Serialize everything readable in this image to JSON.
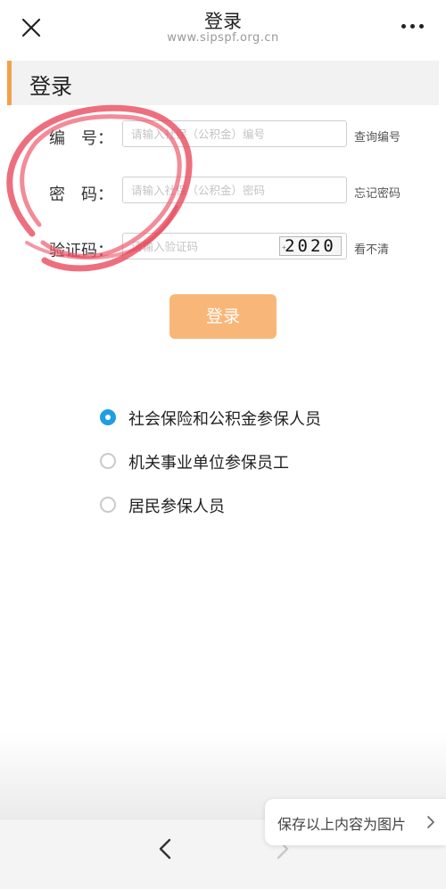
{
  "nav": {
    "title": "登录",
    "url": "www.sipspf.org.cn",
    "close_icon": "close-icon",
    "more_icon": "more-icon"
  },
  "section": {
    "title": "登录"
  },
  "form": {
    "id_label": "编　号：",
    "id_placeholder": "请输入社保（公积金）编号",
    "id_link": "查询编号",
    "password_label": "密　码：",
    "password_placeholder": "请输入社保（公积金）密码",
    "password_link": "忘记密码",
    "captcha_label": "验证码：",
    "captcha_placeholder": "请输入验证码",
    "captcha_value": "2020",
    "captcha_link": "看不清"
  },
  "login_button": {
    "label": "登录"
  },
  "user_types": {
    "selected_index": 0,
    "options": [
      {
        "label": "社会保险和公积金参保人员",
        "checked": true
      },
      {
        "label": "机关事业单位参保员工",
        "checked": false
      },
      {
        "label": "居民参保人员",
        "checked": false
      }
    ]
  },
  "bottom": {
    "save_toast": "保存以上内容为图片",
    "back_icon": "chevron-left-icon",
    "forward_icon": "chevron-right-icon"
  },
  "colors": {
    "accent": "#f3a24a",
    "login_button": "#f8b779",
    "radio_checked": "#1f9fe2",
    "annotation": "#e8475a"
  }
}
